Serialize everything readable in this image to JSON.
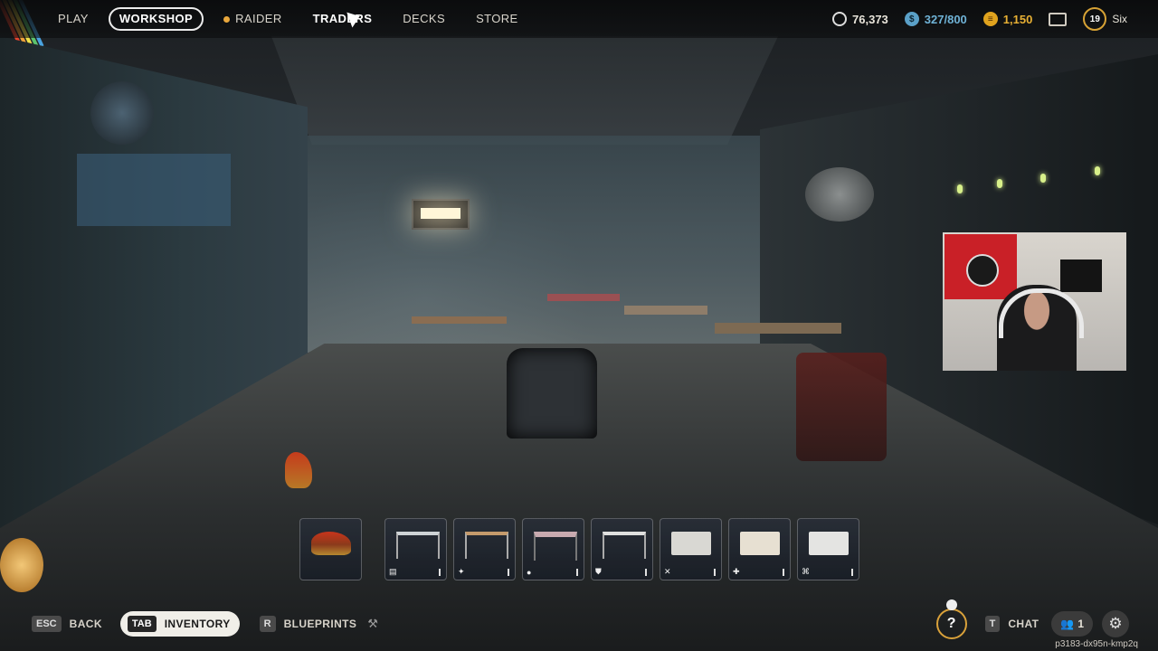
{
  "nav": {
    "items": [
      {
        "label": "PLAY"
      },
      {
        "label": "WORKSHOP",
        "active": true
      },
      {
        "label": "RAIDER",
        "icon": "raider-dot-icon"
      },
      {
        "label": "TRADERS"
      },
      {
        "label": "DECKS"
      },
      {
        "label": "STORE"
      }
    ]
  },
  "currency": {
    "raider_coins": "76,373",
    "cred": "327/800",
    "gold": "1,150",
    "level": "19",
    "username": "Six"
  },
  "hotbar": {
    "slots": [
      {
        "name": "rooster",
        "icon": "rooster-icon"
      },
      {
        "name": "workbench-1",
        "icon": "floppy-icon",
        "badge": "▤"
      },
      {
        "name": "workbench-2",
        "icon": "explosive-icon",
        "badge": "✦"
      },
      {
        "name": "workbench-3",
        "icon": "grenade-icon",
        "badge": "●"
      },
      {
        "name": "workbench-4",
        "icon": "shield-icon",
        "badge": "⛊"
      },
      {
        "name": "workbench-5",
        "icon": "crossed-tools-icon",
        "badge": "✕"
      },
      {
        "name": "workbench-6",
        "icon": "medical-icon",
        "badge": "✚"
      },
      {
        "name": "workbench-7",
        "icon": "scrappy-icon",
        "badge": "⌘"
      }
    ]
  },
  "bottom": {
    "back_key": "ESC",
    "back_label": "BACK",
    "inventory_key": "TAB",
    "inventory_label": "INVENTORY",
    "blueprints_key": "R",
    "blueprints_label": "BLUEPRINTS",
    "chat_key": "T",
    "chat_label": "CHAT",
    "party_count": "1",
    "help_glyph": "?",
    "session_id": "p3183-dx95n-kmp2q"
  },
  "colors": {
    "accent_gold": "#d9a13a",
    "cred_blue": "#5aa0c8",
    "gold_coin": "#e0a31e"
  }
}
